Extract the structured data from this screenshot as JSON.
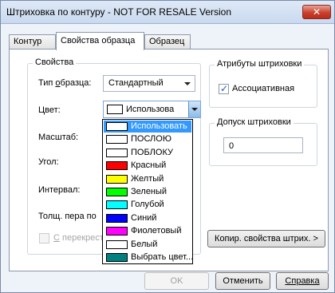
{
  "window": {
    "title": "Штриховка по контуру - NOT FOR RESALE Version",
    "close_glyph": "✕"
  },
  "tabs": [
    {
      "label": "Контур",
      "active": false
    },
    {
      "label": "Свойства образца",
      "active": true
    },
    {
      "label": "Образец",
      "active": false
    }
  ],
  "properties": {
    "group_title": "Свойства",
    "pattern_type_label_pre": "Тип ",
    "pattern_type_label_u": "о",
    "pattern_type_label_post": "бразца:",
    "pattern_type_value": "Стандартный",
    "color_label": "Цвет:",
    "color_value": "Использова",
    "scale_label": "Масштаб:",
    "angle_label": "Угол:",
    "interval_label": "Интервал:",
    "pen_width_label": "Толщ. пера по",
    "crosshatch_label_pre": "С",
    "crosshatch_label_post": " перекрест"
  },
  "hatch_attributes": {
    "group_title": "Атрибуты штриховки",
    "associative_label": "Ассоциативная",
    "associative_checked": true
  },
  "tolerance": {
    "group_title": "Допуск штриховки",
    "value": "0"
  },
  "color_options": [
    {
      "label": "Использовать",
      "swatch": "#ffffff",
      "selected": true
    },
    {
      "label": "ПОСЛОЮ",
      "swatch": "#ffffff",
      "selected": false
    },
    {
      "label": "ПОБЛОКУ",
      "swatch": "#ffffff",
      "selected": false
    },
    {
      "label": "Красный",
      "swatch": "#ff0000",
      "selected": false
    },
    {
      "label": "Желтый",
      "swatch": "#ffff00",
      "selected": false
    },
    {
      "label": "Зеленый",
      "swatch": "#00ff00",
      "selected": false
    },
    {
      "label": "Голубой",
      "swatch": "#00ffff",
      "selected": false
    },
    {
      "label": "Синий",
      "swatch": "#0000ff",
      "selected": false
    },
    {
      "label": "Фиолетовый",
      "swatch": "#ff00ff",
      "selected": false
    },
    {
      "label": "Белый",
      "swatch": "#ffffff",
      "selected": false
    },
    {
      "label": "Выбрать цвет...",
      "swatch": "#008080",
      "selected": false
    }
  ],
  "buttons": {
    "copy_props": "Копир. свойства штрих. >",
    "ok": "OK",
    "cancel": "Отменить",
    "help": "Справка"
  }
}
